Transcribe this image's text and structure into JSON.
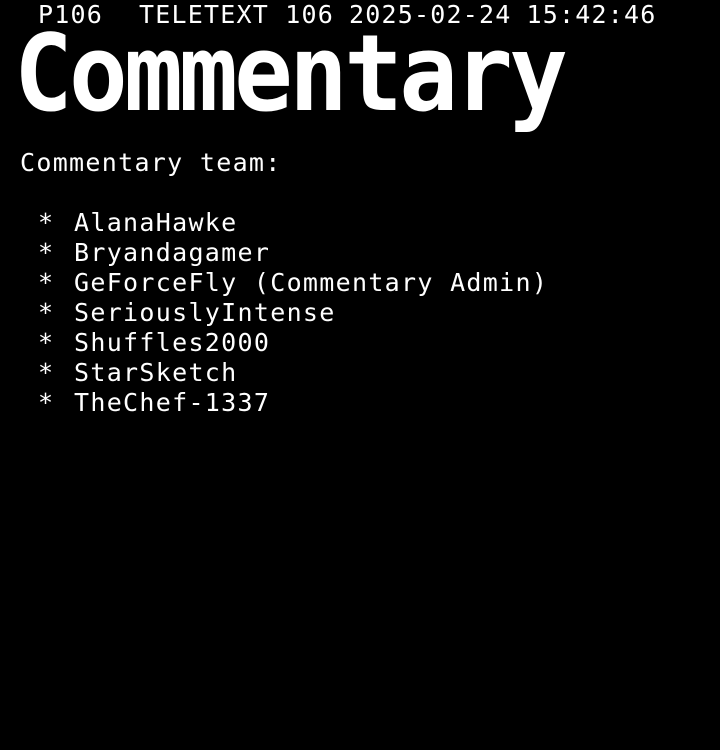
{
  "header": {
    "page_number": "P106",
    "service": "TELETEXT 106",
    "date": "2025-02-24",
    "time": "15:42:46"
  },
  "title": "Commentary",
  "subtitle": "Commentary team:",
  "bullet": "*",
  "team": [
    "AlanaHawke",
    "Bryandagamer",
    "GeForceFly (Commentary Admin)",
    "SeriouslyIntense",
    "Shuffles2000",
    "StarSketch",
    "TheChef-1337"
  ],
  "colors": {
    "background": "#000000",
    "text": "#ffffff"
  }
}
